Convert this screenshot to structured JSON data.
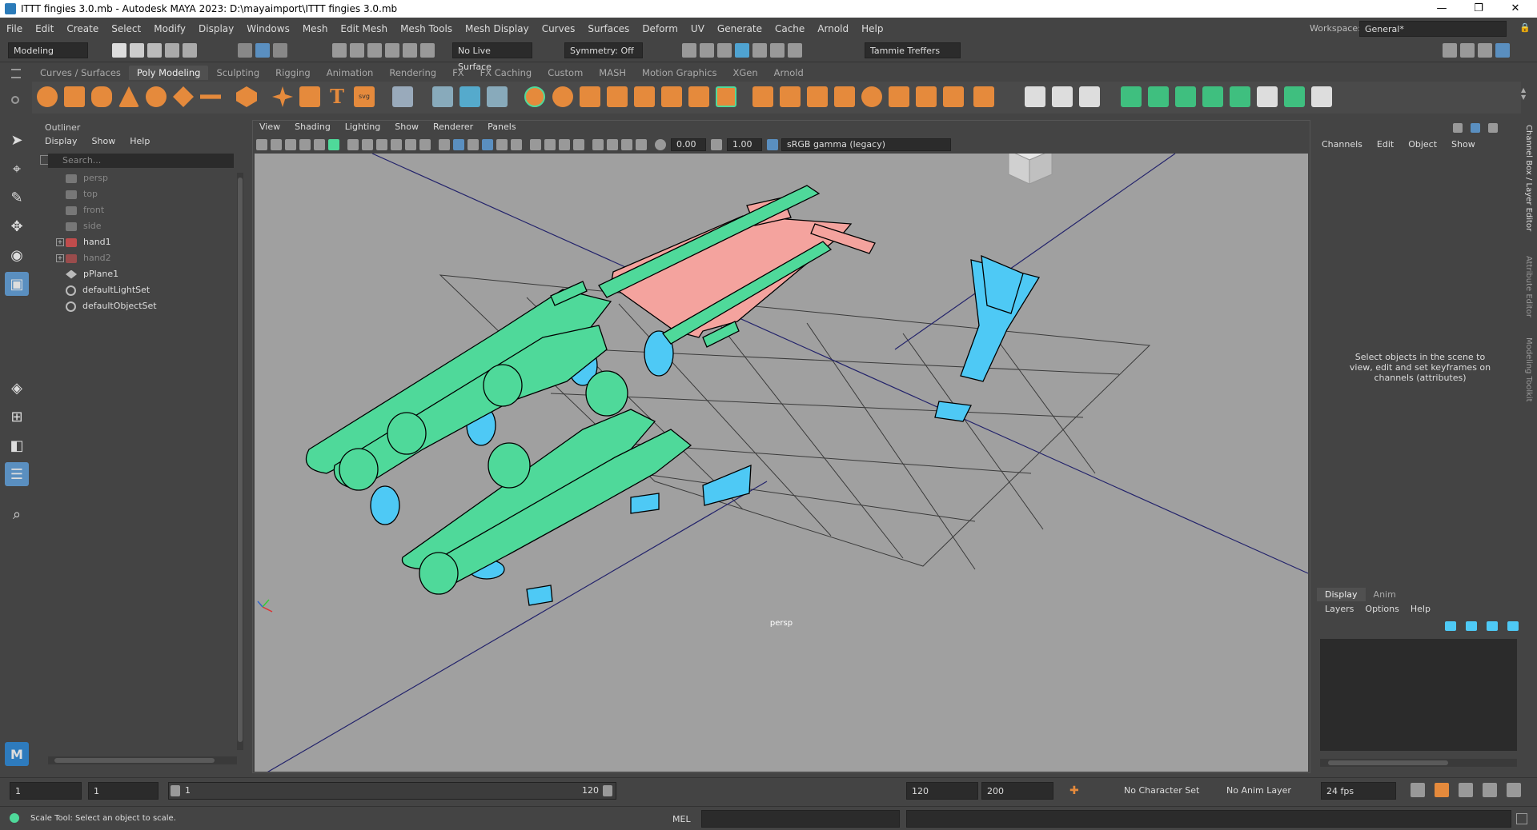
{
  "title": "ITTT fingies 3.0.mb - Autodesk MAYA 2023: D:\\mayaimport\\ITTT fingies 3.0.mb",
  "window_controls": {
    "minimize": "—",
    "restore": "❐",
    "close": "✕"
  },
  "menu": [
    "File",
    "Edit",
    "Create",
    "Select",
    "Modify",
    "Display",
    "Windows",
    "Mesh",
    "Edit Mesh",
    "Mesh Tools",
    "Mesh Display",
    "Curves",
    "Surfaces",
    "Deform",
    "UV",
    "Generate",
    "Cache",
    "Arnold",
    "Help"
  ],
  "workspace": {
    "label": "Workspace:",
    "value": "General*"
  },
  "status": {
    "mode": "Modeling",
    "live_surface": "No Live Surface",
    "symmetry": "Symmetry: Off",
    "user": "Tammie Treffers"
  },
  "shelf_tabs": [
    "Curves / Surfaces",
    "Poly Modeling",
    "Sculpting",
    "Rigging",
    "Animation",
    "Rendering",
    "FX",
    "FX Caching",
    "Custom",
    "MASH",
    "Motion Graphics",
    "XGen",
    "Arnold"
  ],
  "shelf_active": "Poly Modeling",
  "outliner": {
    "title": "Outliner",
    "menu": [
      "Display",
      "Show",
      "Help"
    ],
    "search_placeholder": "Search...",
    "items": [
      {
        "label": "persp",
        "dim": true
      },
      {
        "label": "top",
        "dim": true
      },
      {
        "label": "front",
        "dim": true
      },
      {
        "label": "side",
        "dim": true
      },
      {
        "label": "hand1",
        "dim": false
      },
      {
        "label": "hand2",
        "dim": true
      },
      {
        "label": "pPlane1",
        "dim": false
      },
      {
        "label": "defaultLightSet",
        "dim": false
      },
      {
        "label": "defaultObjectSet",
        "dim": false
      }
    ]
  },
  "viewport": {
    "menu": [
      "View",
      "Shading",
      "Lighting",
      "Show",
      "Renderer",
      "Panels"
    ],
    "exposure": "0.00",
    "gamma": "1.00",
    "color_space": "sRGB gamma (legacy)",
    "camera": "persp"
  },
  "channelbox": {
    "menu": [
      "Channels",
      "Edit",
      "Object",
      "Show"
    ],
    "message": "Select objects in the scene to view, edit and set keyframes on channels (attributes)"
  },
  "layer_editor": {
    "tabs": [
      "Display",
      "Anim"
    ],
    "menu": [
      "Layers",
      "Options",
      "Help"
    ]
  },
  "side_tabs": [
    "Channel Box / Layer Editor",
    "Attribute Editor",
    "Modeling Toolkit"
  ],
  "timeslider": {
    "start": "1",
    "current": "1",
    "range_start": "1",
    "range_end": "120",
    "end": "120",
    "max": "200",
    "character_set": "No Character Set",
    "anim_layer": "No Anim Layer",
    "fps": "24 fps"
  },
  "helpline": {
    "text": "Scale Tool: Select an object to scale.",
    "mel_label": "MEL"
  },
  "colors": {
    "green": "#4fd99a",
    "pink": "#f4a39e",
    "cyan": "#4ec9f5",
    "grid": "#3a3a3a"
  }
}
